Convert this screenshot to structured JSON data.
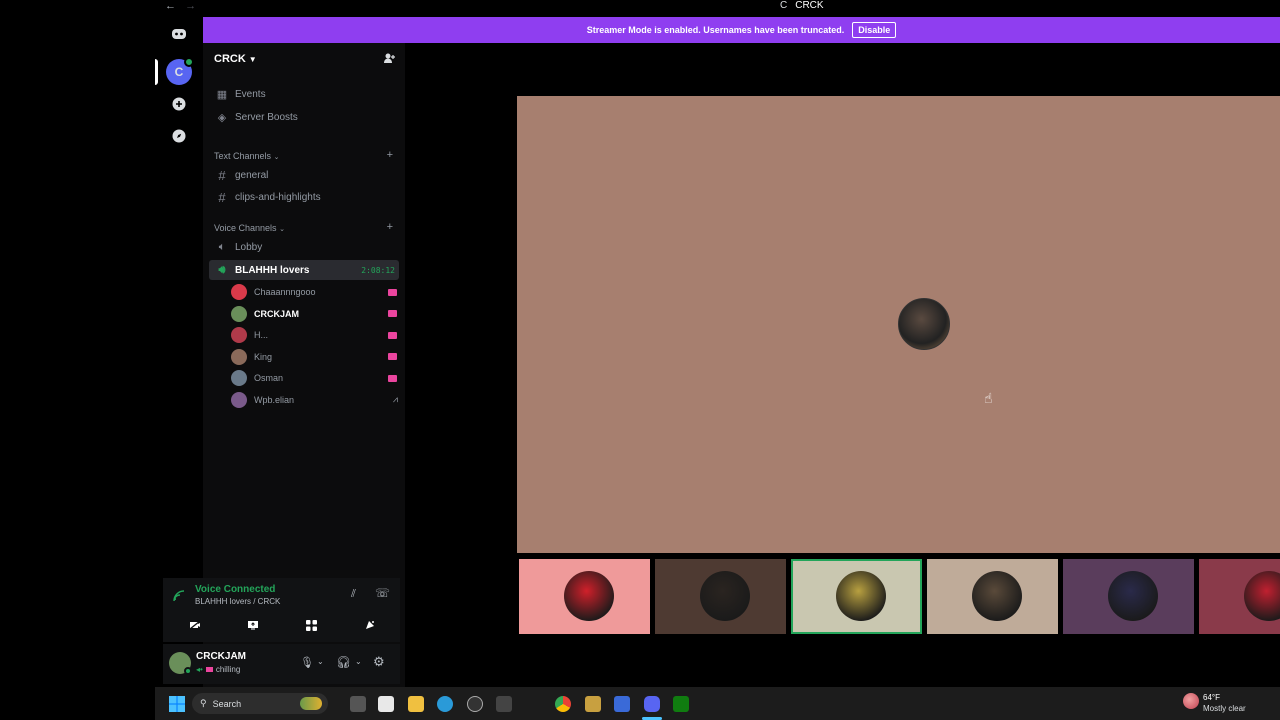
{
  "window": {
    "title": "CRCK",
    "title_prefix": "C",
    "back": "←",
    "forward": "→"
  },
  "banner": {
    "text": "Streamer Mode is enabled. Usernames have been truncated.",
    "button": "Disable"
  },
  "rail": {
    "server_letter": "C"
  },
  "server": {
    "name": "CRCK"
  },
  "nav_items": [
    {
      "label": "Events",
      "icon": "calendar-icon"
    },
    {
      "label": "Server Boosts",
      "icon": "boost-icon"
    }
  ],
  "text_category": "Text Channels",
  "text_channels": [
    {
      "label": "general"
    },
    {
      "label": "clips-and-highlights"
    }
  ],
  "voice_category": "Voice Channels",
  "voice_channels": [
    {
      "label": "Lobby"
    },
    {
      "label": "BLAHHH lovers",
      "timer": "2:08:12",
      "active": true
    }
  ],
  "members": [
    {
      "name": "Chaaannngooo",
      "status": "live",
      "color": "#d93a4a"
    },
    {
      "name": "CRCKJAM",
      "status": "live",
      "color": "#6a8f5a",
      "highlight": true
    },
    {
      "name": "H...",
      "status": "live",
      "color": "#b03a4a"
    },
    {
      "name": "King",
      "status": "live",
      "color": "#8a6a5a"
    },
    {
      "name": "Osman",
      "status": "live",
      "color": "#6a7a8a"
    },
    {
      "name": "Wpb.elian",
      "status": "activity",
      "color": "#7a5a8a"
    }
  ],
  "voice_panel": {
    "status": "Voice Connected",
    "channel": "BLAHHH lovers / CRCK"
  },
  "user_panel": {
    "name": "CRCKJAM",
    "status": "chilling"
  },
  "tiles": [
    {
      "bg": "#ef9a9a",
      "avatar": "#d0202a",
      "label": "tile-1"
    },
    {
      "bg": "#4e3a32",
      "avatar": "#2a2420",
      "label": "tile-2"
    },
    {
      "bg": "#c9c7b0",
      "avatar": "#b8a040",
      "label": "tile-3",
      "speaking": true
    },
    {
      "bg": "#bfab99",
      "avatar": "#5a4a3a",
      "label": "tile-4"
    },
    {
      "bg": "#5a3d5c",
      "avatar": "#2a2a4a",
      "label": "tile-5"
    },
    {
      "bg": "#8a3a4a",
      "avatar": "#c02030",
      "label": "tile-6"
    }
  ],
  "taskbar": {
    "search": "Search",
    "weather_temp": "64°F",
    "weather_desc": "Mostly clear"
  },
  "colors": {
    "accent": "#8f3ef0",
    "brand": "#5865f2",
    "connected": "#23a55a",
    "live": "#eb459e"
  }
}
